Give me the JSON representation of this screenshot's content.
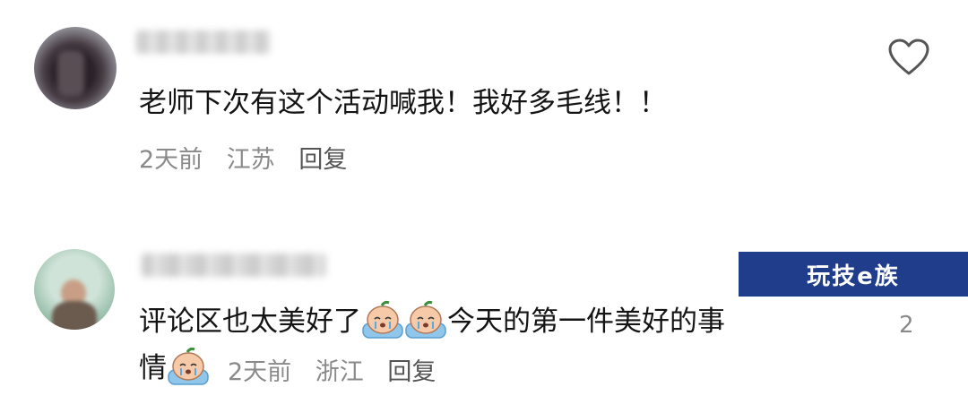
{
  "comments": [
    {
      "text": "老师下次有这个活动喊我！我好多毛线！！",
      "time": "2天前",
      "location": "江苏",
      "reply_label": "回复"
    },
    {
      "text_part1": "评论区也太美好了",
      "text_part2": "今天的第一件美好的事",
      "text_part3": "情",
      "time": "2天前",
      "location": "浙江",
      "reply_label": "回复",
      "like_count": "2"
    }
  ],
  "watermark": "玩技e族",
  "icons": {
    "like": "heart-outline-icon",
    "emoji": "crying-face-emoji"
  }
}
